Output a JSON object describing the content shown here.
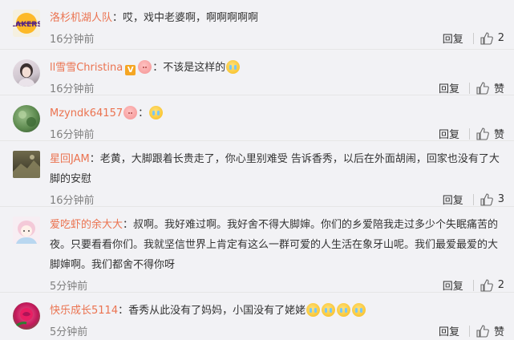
{
  "comments": [
    {
      "username": "洛杉机湖人队",
      "text": "：哎，戏中老婆啊，啊啊啊啊啊",
      "time": "16分钟前",
      "reply": "回复",
      "likes": "2",
      "avatar": "lakers-logo"
    },
    {
      "username": "ll雪雪Christina",
      "text": "：不该是这样的",
      "time": "16分钟前",
      "reply": "回复",
      "likes": "赞",
      "avatar": "girl-photo"
    },
    {
      "username": "Mzyndk64157",
      "text": "：",
      "time": "16分钟前",
      "reply": "回复",
      "likes": "赞",
      "avatar": "green-photo"
    },
    {
      "username": "星回JAM",
      "text": "：老黄，大脚跟着长贵走了，你心里别难受 告诉香秀，以后在外面胡闹，回家也没有了大脚的安慰",
      "time": "16分钟前",
      "reply": "回复",
      "likes": "3",
      "avatar": "landscape-photo"
    },
    {
      "username": "爱吃虾的余大大",
      "text": "：叔啊。我好难过啊。我好舍不得大脚婶。你们的乡爱陪我走过多少个失眠痛苦的夜。只要看看你们。我就坚信世界上肯定有这么一群可爱的人生活在象牙山呢。我们最爱最爱的大脚婶啊。我们都舍不得你呀",
      "time": "5分钟前",
      "reply": "回复",
      "likes": "2",
      "avatar": "cartoon-girl"
    },
    {
      "username": "快乐成长5114",
      "text": "：香秀从此没有了妈妈，小国没有了姥姥",
      "time": "5分钟前",
      "reply": "回复",
      "likes": "赞",
      "avatar": "rose-photo"
    }
  ]
}
